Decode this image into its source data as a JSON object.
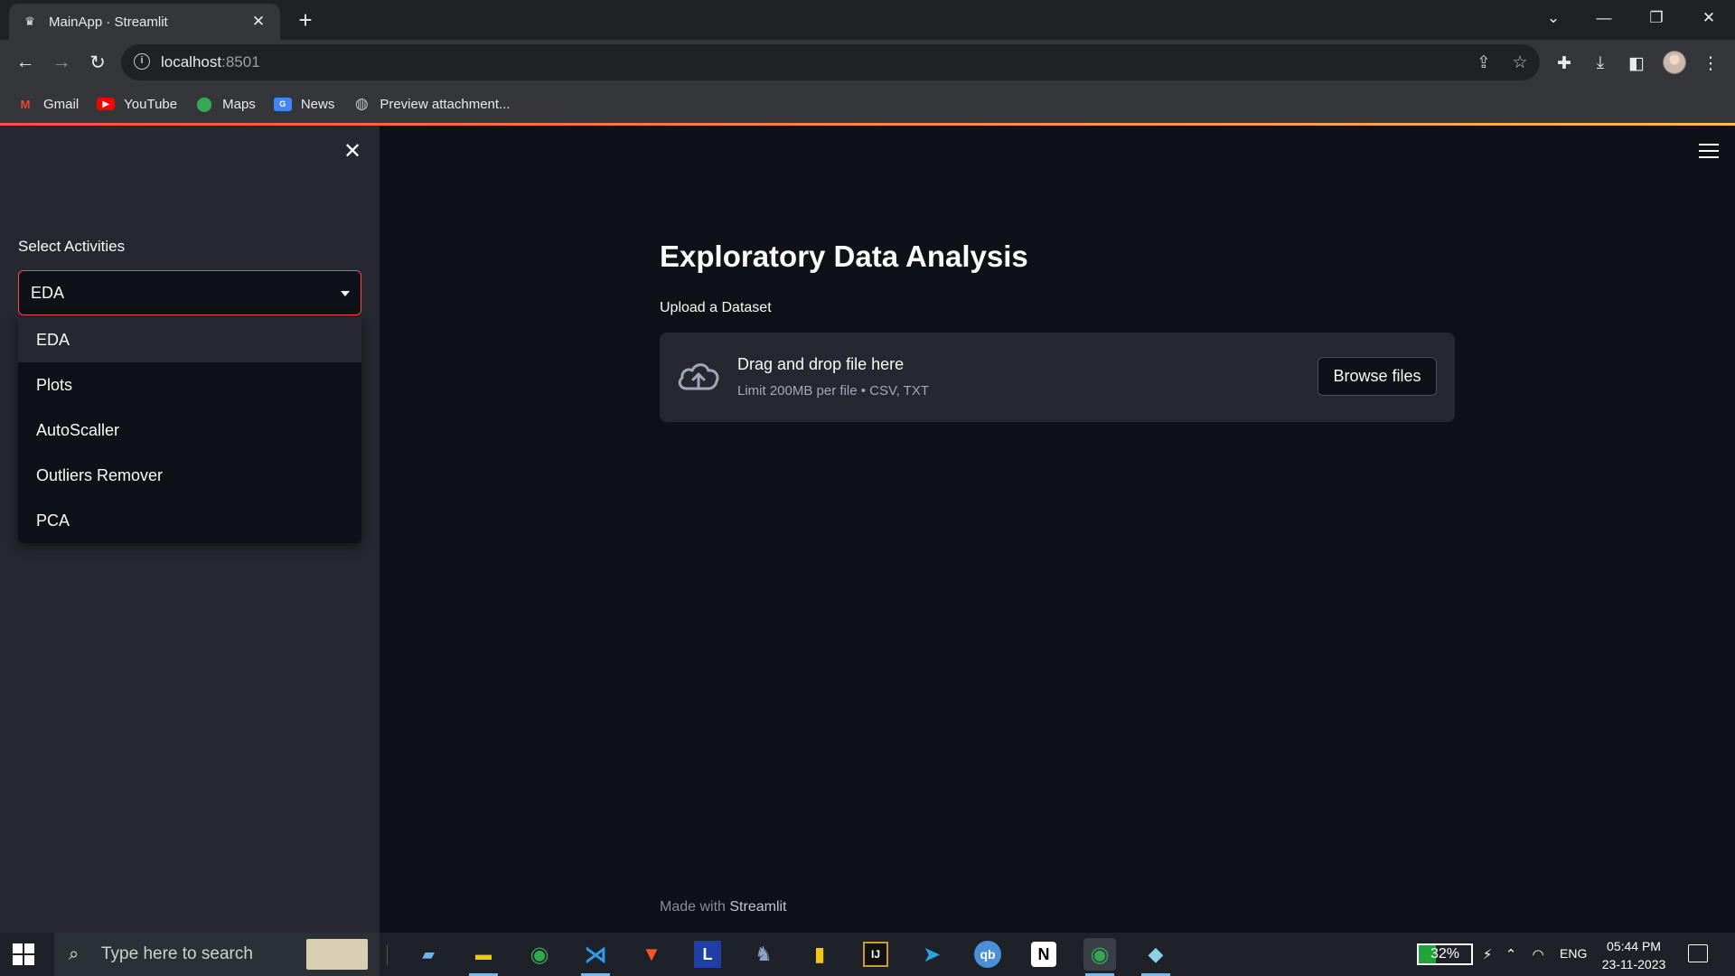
{
  "browser": {
    "tab_title": "MainApp · Streamlit",
    "url_host": "localhost",
    "url_port": ":8501",
    "bookmarks": [
      {
        "label": "Gmail",
        "icon": "gmail-icon",
        "color": "#ea4335"
      },
      {
        "label": "YouTube",
        "icon": "youtube-icon",
        "color": "#ff0000"
      },
      {
        "label": "Maps",
        "icon": "maps-icon",
        "color": "#34a853"
      },
      {
        "label": "News",
        "icon": "news-icon",
        "color": "#4285f4"
      },
      {
        "label": "Preview attachment...",
        "icon": "globe-icon",
        "color": "#bdc1c6"
      }
    ]
  },
  "sidebar": {
    "select_label": "Select Activities",
    "selected_value": "EDA",
    "options": [
      "EDA",
      "Plots",
      "AutoScaller",
      "Outliers Remover",
      "PCA"
    ]
  },
  "main": {
    "title": "Exploratory Data Analysis",
    "upload_label": "Upload a Dataset",
    "dropzone_title": "Drag and drop file here",
    "dropzone_subtitle": "Limit 200MB per file • CSV, TXT",
    "browse_button": "Browse files",
    "footer_prefix": "Made with ",
    "footer_brand": "Streamlit"
  },
  "taskbar": {
    "search_placeholder": "Type here to search",
    "battery_percent": "32%",
    "battery_level": 0.32,
    "language": "ENG",
    "time": "05:44 PM",
    "date": "23-11-2023"
  },
  "colors": {
    "accent": "#ff4b4b",
    "background": "#0e1117",
    "sidebar": "#262730"
  }
}
